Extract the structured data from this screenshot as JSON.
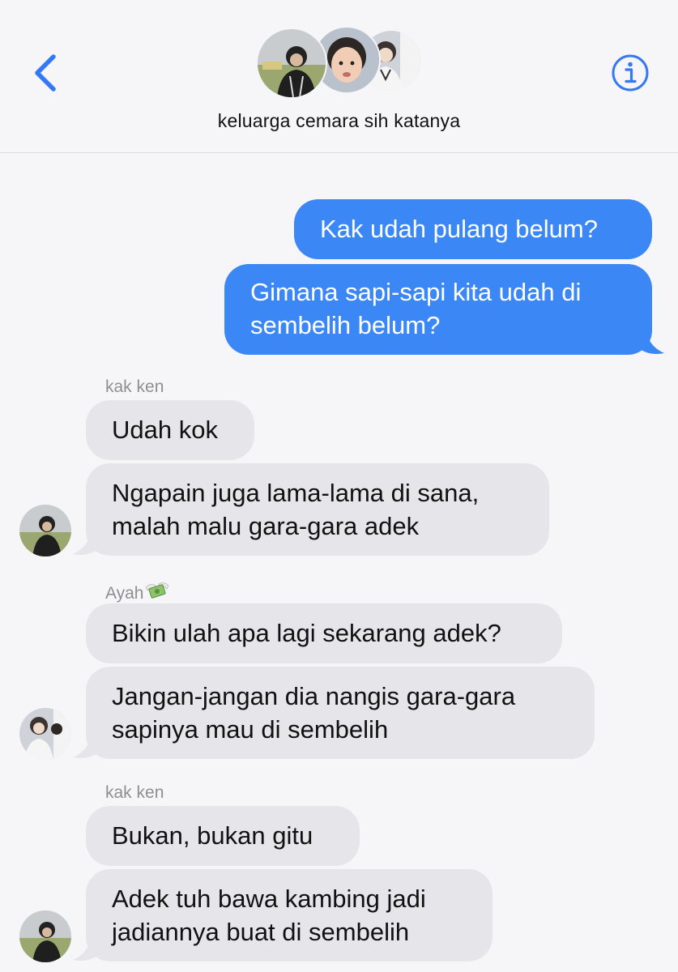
{
  "header": {
    "group_name": "keluarga cemara sih katanya",
    "back_icon": "chevron-left-icon",
    "info_icon": "info-circle-icon"
  },
  "colors": {
    "outgoing_bubble": "#3b87f5",
    "incoming_bubble": "#e6e5ea",
    "accent": "#3478f6",
    "background": "#f6f6f8",
    "sender_label": "#8e8e93"
  },
  "messages": [
    {
      "direction": "outgoing",
      "text": "Kak udah pulang belum?"
    },
    {
      "direction": "outgoing",
      "text": "Gimana sapi-sapi kita udah di\nsembelih belum?"
    },
    {
      "direction": "incoming",
      "sender": "kak ken",
      "text": "Udah kok"
    },
    {
      "direction": "incoming",
      "text": "Ngapain juga lama-lama di sana,\nmalah malu gara-gara adek"
    },
    {
      "direction": "incoming",
      "sender": "Ayah",
      "sender_emoji": "money-with-wings-icon",
      "text": "Bikin ulah apa lagi sekarang adek?"
    },
    {
      "direction": "incoming",
      "text": "Jangan-jangan dia nangis gara-gara\nsapinya mau di sembelih"
    },
    {
      "direction": "incoming",
      "sender": "kak ken",
      "text": "Bukan, bukan gitu"
    },
    {
      "direction": "incoming",
      "text": "Adek tuh bawa kambing jadi\njadiannya buat di sembelih"
    }
  ]
}
